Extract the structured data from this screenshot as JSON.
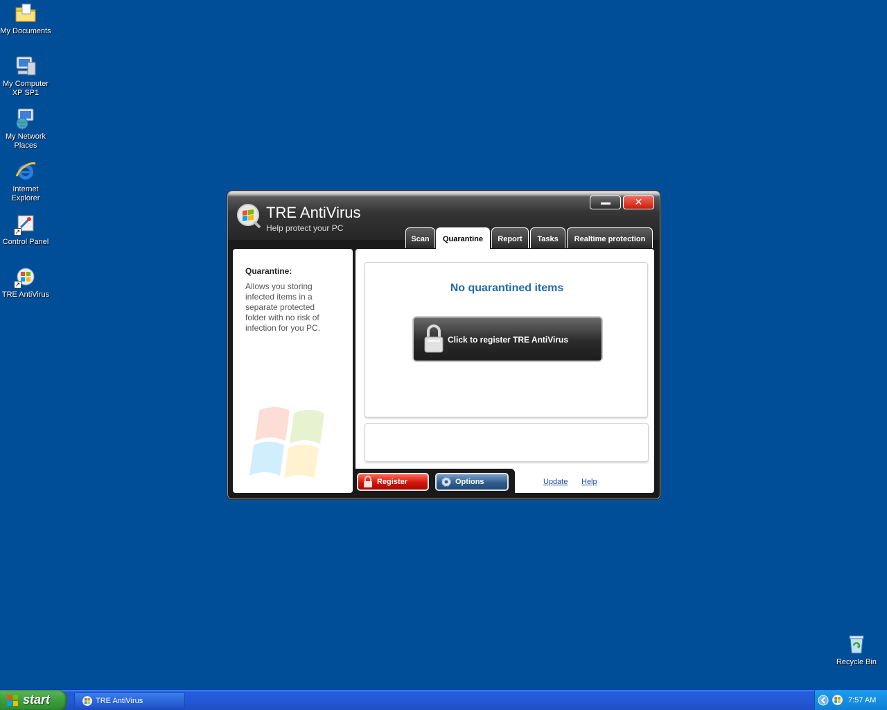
{
  "desktop": {
    "icons": [
      {
        "label": "My Documents"
      },
      {
        "label": "My Computer\nXP SP1"
      },
      {
        "label": "My Network Places"
      },
      {
        "label": "Internet Explorer"
      },
      {
        "label": "Control Panel"
      },
      {
        "label": "TRE AntiVirus"
      }
    ],
    "recycle_bin": {
      "label": "Recycle Bin"
    }
  },
  "app": {
    "title": "TRE AntiVirus",
    "subtitle": "Help protect your PC",
    "tabs": [
      {
        "label": "Scan"
      },
      {
        "label": "Quarantine"
      },
      {
        "label": "Report"
      },
      {
        "label": "Tasks"
      },
      {
        "label": "Realtime protection"
      }
    ],
    "active_tab": "Quarantine",
    "side": {
      "title": "Quarantine:",
      "text": "Allows you storing infected items in a separate protected folder with no risk of infection for you PC."
    },
    "main": {
      "message": "No quarantined items",
      "register_big_label": "Click to register TRE AntiVirus"
    },
    "bottom": {
      "register_label": "Register",
      "options_label": "Options",
      "update_link": "Update",
      "help_link": "Help"
    }
  },
  "taskbar": {
    "start_label": "start",
    "task_label": "TRE AntiVirus",
    "clock": "7:57 AM"
  },
  "colors": {
    "desktop_bg": "#004e98",
    "accent_blue": "#1e6aa8",
    "register_red": "#d3140a",
    "options_blue": "#2f5f90"
  }
}
